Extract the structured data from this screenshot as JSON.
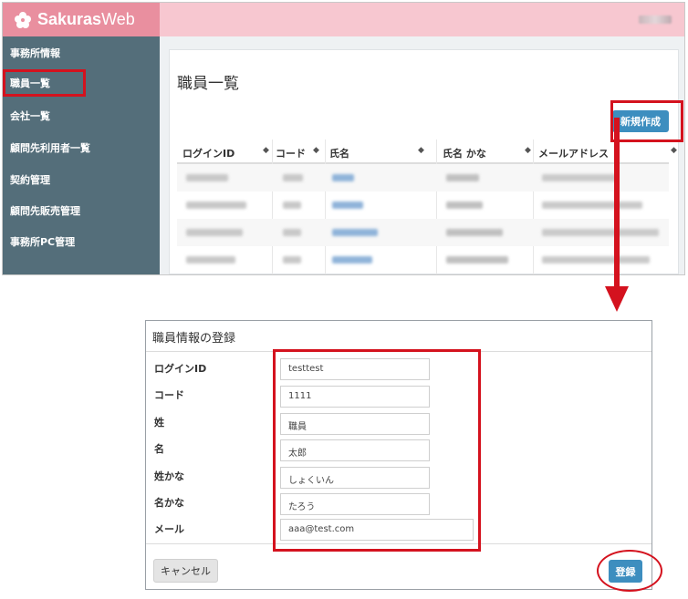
{
  "app": {
    "brand_prefix": "Sakuras",
    "brand_suffix": "Web",
    "logo_icon": "sakura-flower-icon"
  },
  "colors": {
    "brand_pink": "#e98f9f",
    "header_pink": "#f7c7d0",
    "sidebar": "#546e7a",
    "primary_button": "#3d8ebf",
    "annotation_red": "#d4121e"
  },
  "sidebar": {
    "items": [
      {
        "label": "事務所情報"
      },
      {
        "label": "職員一覧"
      },
      {
        "label": "会社一覧"
      },
      {
        "label": "顧問先利用者一覧"
      },
      {
        "label": "契約管理"
      },
      {
        "label": "顧問先販売管理"
      },
      {
        "label": "事務所PC管理"
      }
    ]
  },
  "main": {
    "page_title": "職員一覧",
    "new_button": "新規作成",
    "sort_icon": "◆",
    "columns": [
      {
        "label": "ログインID"
      },
      {
        "label": "コード"
      },
      {
        "label": "氏名"
      },
      {
        "label": "氏名 かな"
      },
      {
        "label": "メールアドレス"
      }
    ]
  },
  "dialog": {
    "title": "職員情報の登録",
    "fields": [
      {
        "label": "ログインID",
        "value": "testtest"
      },
      {
        "label": "コード",
        "value": "1111"
      },
      {
        "label": "姓",
        "value": "職員"
      },
      {
        "label": "名",
        "value": "太郎"
      },
      {
        "label": "姓かな",
        "value": "しょくいん"
      },
      {
        "label": "名かな",
        "value": "たろう"
      },
      {
        "label": "メール",
        "value": "aaa@test.com"
      }
    ],
    "cancel_button": "キャンセル",
    "register_button": "登録"
  }
}
